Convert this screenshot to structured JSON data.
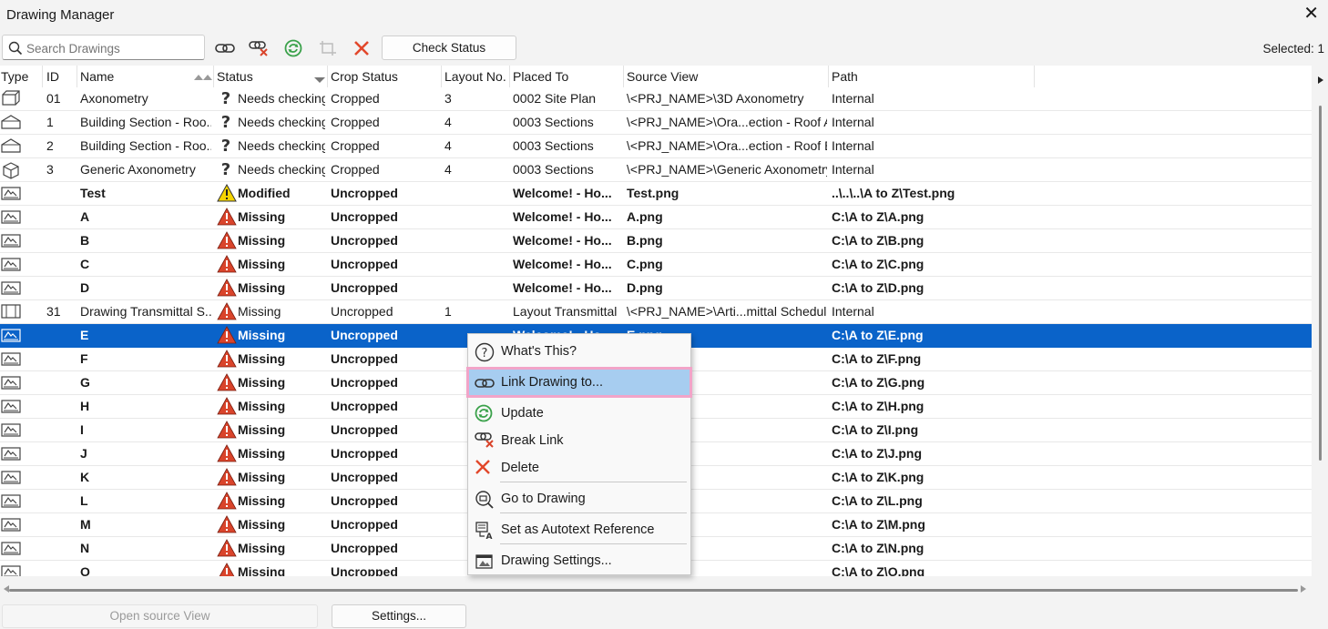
{
  "window": {
    "title": "Drawing Manager"
  },
  "toolbar": {
    "search_placeholder": "Search Drawings",
    "check_status": "Check Status",
    "selected_text": "Selected: 1"
  },
  "columns": [
    "Type",
    "ID",
    "Name",
    "Status",
    "Crop Status",
    "Layout No.",
    "Placed To",
    "Source View",
    "Path"
  ],
  "rows": [
    {
      "type": "axon",
      "id": "01",
      "name": "Axonometry",
      "status_icon": "question",
      "status": "Needs checking",
      "crop": "Cropped",
      "layout": "3",
      "placed": "0002 Site Plan",
      "source": "\\<PRJ_NAME>\\3D Axonometry",
      "path": "Internal",
      "bold": false
    },
    {
      "type": "section",
      "id": "1",
      "name": "Building Section - Roo...",
      "status_icon": "question",
      "status": "Needs checking",
      "crop": "Cropped",
      "layout": "4",
      "placed": "0003 Sections",
      "source": "\\<PRJ_NAME>\\Ora...ection - Roof A",
      "path": "Internal",
      "bold": false
    },
    {
      "type": "section",
      "id": "2",
      "name": "Building Section - Roo...",
      "status_icon": "question",
      "status": "Needs checking",
      "crop": "Cropped",
      "layout": "4",
      "placed": "0003 Sections",
      "source": "\\<PRJ_NAME>\\Ora...ection - Roof B",
      "path": "Internal",
      "bold": false
    },
    {
      "type": "cube",
      "id": "3",
      "name": "Generic Axonometry",
      "status_icon": "question",
      "status": "Needs checking",
      "crop": "Cropped",
      "layout": "4",
      "placed": "0003 Sections",
      "source": "\\<PRJ_NAME>\\Generic Axonometry",
      "path": "Internal",
      "bold": false
    },
    {
      "type": "image",
      "id": "",
      "name": "Test",
      "status_icon": "warn-yellow",
      "status": "Modified",
      "crop": "Uncropped",
      "layout": "",
      "placed": "Welcome! - Ho...",
      "source": "Test.png",
      "path": "..\\..\\..\\A to Z\\Test.png",
      "bold": true
    },
    {
      "type": "image",
      "id": "",
      "name": "A",
      "status_icon": "warn-red",
      "status": "Missing",
      "crop": "Uncropped",
      "layout": "",
      "placed": "Welcome! - Ho...",
      "source": "A.png",
      "path": "C:\\A to Z\\A.png",
      "bold": true
    },
    {
      "type": "image",
      "id": "",
      "name": "B",
      "status_icon": "warn-red",
      "status": "Missing",
      "crop": "Uncropped",
      "layout": "",
      "placed": "Welcome! - Ho...",
      "source": "B.png",
      "path": "C:\\A to Z\\B.png",
      "bold": true
    },
    {
      "type": "image",
      "id": "",
      "name": "C",
      "status_icon": "warn-red",
      "status": "Missing",
      "crop": "Uncropped",
      "layout": "",
      "placed": "Welcome! - Ho...",
      "source": "C.png",
      "path": "C:\\A to Z\\C.png",
      "bold": true
    },
    {
      "type": "image",
      "id": "",
      "name": "D",
      "status_icon": "warn-red",
      "status": "Missing",
      "crop": "Uncropped",
      "layout": "",
      "placed": "Welcome! - Ho...",
      "source": "D.png",
      "path": "C:\\A to Z\\D.png",
      "bold": true
    },
    {
      "type": "schedule",
      "id": "31",
      "name": "Drawing Transmittal S...",
      "status_icon": "warn-red",
      "status": "Missing",
      "crop": "Uncropped",
      "layout": "1",
      "placed": "Layout Transmittal",
      "source": "\\<PRJ_NAME>\\Arti...mittal Schedule",
      "path": "Internal",
      "bold": false
    },
    {
      "type": "image",
      "id": "",
      "name": "E",
      "status_icon": "warn-red",
      "status": "Missing",
      "crop": "Uncropped",
      "layout": "",
      "placed": "Welcome! - Ho...",
      "source": "E.png",
      "path": "C:\\A to Z\\E.png",
      "bold": true,
      "selected": true
    },
    {
      "type": "image",
      "id": "",
      "name": "F",
      "status_icon": "warn-red",
      "status": "Missing",
      "crop": "Uncropped",
      "layout": "",
      "placed": "",
      "source": "",
      "path": "C:\\A to Z\\F.png",
      "bold": true
    },
    {
      "type": "image",
      "id": "",
      "name": "G",
      "status_icon": "warn-red",
      "status": "Missing",
      "crop": "Uncropped",
      "layout": "",
      "placed": "",
      "source": "",
      "path": "C:\\A to Z\\G.png",
      "bold": true
    },
    {
      "type": "image",
      "id": "",
      "name": "H",
      "status_icon": "warn-red",
      "status": "Missing",
      "crop": "Uncropped",
      "layout": "",
      "placed": "",
      "source": "",
      "path": "C:\\A to Z\\H.png",
      "bold": true
    },
    {
      "type": "image",
      "id": "",
      "name": "I",
      "status_icon": "warn-red",
      "status": "Missing",
      "crop": "Uncropped",
      "layout": "",
      "placed": "",
      "source": "",
      "path": "C:\\A to Z\\I.png",
      "bold": true
    },
    {
      "type": "image",
      "id": "",
      "name": "J",
      "status_icon": "warn-red",
      "status": "Missing",
      "crop": "Uncropped",
      "layout": "",
      "placed": "",
      "source": "",
      "path": "C:\\A to Z\\J.png",
      "bold": true
    },
    {
      "type": "image",
      "id": "",
      "name": "K",
      "status_icon": "warn-red",
      "status": "Missing",
      "crop": "Uncropped",
      "layout": "",
      "placed": "",
      "source": "",
      "path": "C:\\A to Z\\K.png",
      "bold": true
    },
    {
      "type": "image",
      "id": "",
      "name": "L",
      "status_icon": "warn-red",
      "status": "Missing",
      "crop": "Uncropped",
      "layout": "",
      "placed": "",
      "source": "",
      "path": "C:\\A to Z\\L.png",
      "bold": true
    },
    {
      "type": "image",
      "id": "",
      "name": "M",
      "status_icon": "warn-red",
      "status": "Missing",
      "crop": "Uncropped",
      "layout": "",
      "placed": "",
      "source": "",
      "path": "C:\\A to Z\\M.png",
      "bold": true
    },
    {
      "type": "image",
      "id": "",
      "name": "N",
      "status_icon": "warn-red",
      "status": "Missing",
      "crop": "Uncropped",
      "layout": "",
      "placed": "",
      "source": "",
      "path": "C:\\A to Z\\N.png",
      "bold": true
    },
    {
      "type": "image",
      "id": "",
      "name": "O",
      "status_icon": "warn-red",
      "status": "Missing",
      "crop": "Uncropped",
      "layout": "",
      "placed": "",
      "source": "",
      "path": "C:\\A to Z\\O.png",
      "bold": true
    }
  ],
  "context_menu": {
    "whats_this": "What's This?",
    "link_drawing": "Link Drawing to...",
    "update": "Update",
    "break_link": "Break Link",
    "delete": "Delete",
    "go_to_drawing": "Go to Drawing",
    "set_autotext": "Set as Autotext Reference",
    "drawing_settings": "Drawing Settings..."
  },
  "bottom": {
    "open_source_view": "Open source View",
    "settings": "Settings..."
  },
  "colors": {
    "selection": "#0a63c9",
    "menu_highlight": "#a7cdf0",
    "menu_highlight_border": "#f2a4c8",
    "warn_red": "#d9442b",
    "warn_yellow": "#f5d400",
    "update_green": "#3aa14a"
  }
}
